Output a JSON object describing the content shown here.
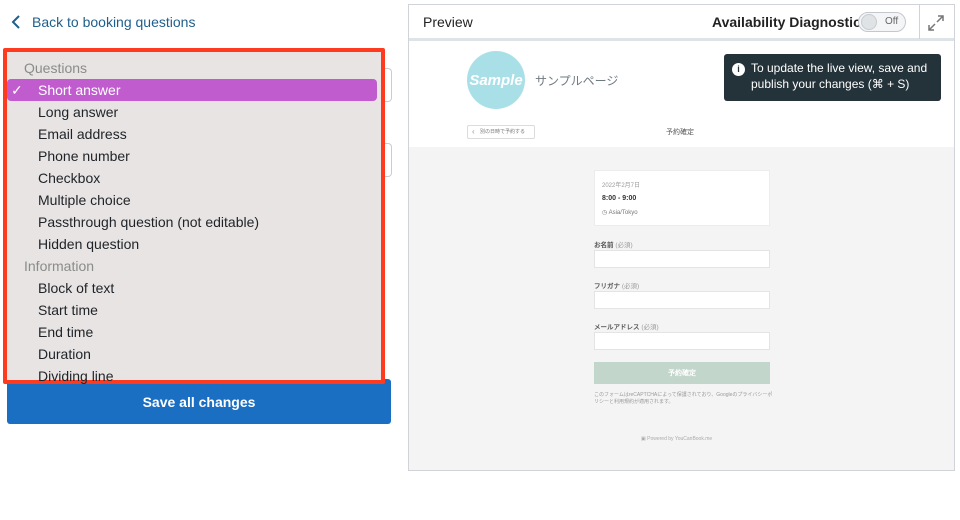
{
  "nav": {
    "back_label": "Back to booking questions"
  },
  "dropdown": {
    "groups": [
      {
        "label": "Questions",
        "items": [
          "Short answer",
          "Long answer",
          "Email address",
          "Phone number",
          "Checkbox",
          "Multiple choice",
          "Passthrough question (not editable)",
          "Hidden question"
        ]
      },
      {
        "label": "Information",
        "items": [
          "Block of text",
          "Start time",
          "End time",
          "Duration",
          "Dividing line"
        ]
      }
    ],
    "selected": "Short answer",
    "check_glyph": "✓",
    "highlight_color": "#ff3b1f",
    "selected_color": "#c15ccf"
  },
  "actions": {
    "save_label": "Save all changes",
    "save_color": "#1b6fc2"
  },
  "preview": {
    "title": "Preview",
    "diagnostics_label": "Availability Diagnostics",
    "toggle_state": "Off",
    "expand_icon": "expand-icon",
    "tooltip": "To update the live view, save and publish your changes (⌘ + S)",
    "booking": {
      "logo_text": "Sample",
      "page_name": "サンプルページ",
      "back_chip": "別の日時で予約する",
      "confirm_title": "予約確定",
      "date": "2022年2月7日",
      "time": "8:00 - 9:00",
      "timezone": "Asia/Tokyo",
      "fields": [
        {
          "label": "お名前",
          "required": "(必須)"
        },
        {
          "label": "フリガナ",
          "required": "(必須)"
        },
        {
          "label": "メールアドレス",
          "required": "(必須)"
        }
      ],
      "submit": "予約確定",
      "recaptcha_text": "このフォームはreCAPTCHAによって保護されており、Googleのプライバシーポリシーと利用規約が適用されます。",
      "powered_by": "Powered by YouCanBook.me"
    }
  }
}
